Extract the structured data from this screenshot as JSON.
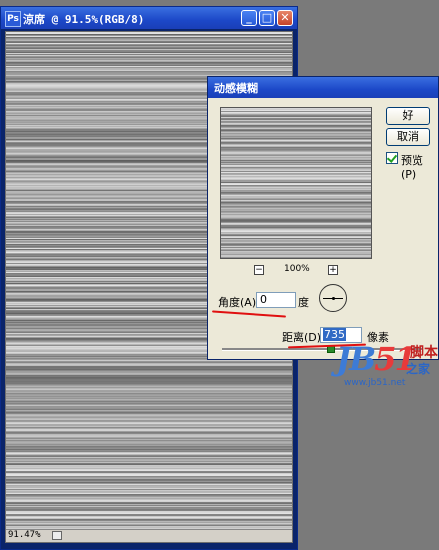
{
  "document": {
    "title": "涼席 @ 91.5%(RGB/8)",
    "minimize_label": "_",
    "restore_label": "□",
    "close_label": "✕",
    "zoom_readout": "91.47%"
  },
  "dialog": {
    "title": "动感模糊",
    "ok_label": "好",
    "cancel_label": "取消",
    "preview_checked": true,
    "preview_label": "预览(P)",
    "zoom_minus": "−",
    "zoom_plus": "+",
    "zoom_value": "100%",
    "angle_label": "角度(A):",
    "angle_value": "0",
    "angle_unit": "度",
    "distance_label": "距离(D):",
    "distance_value": "735",
    "distance_unit": "像素"
  },
  "watermark": {
    "logo_main": "JB",
    "logo_accent": "51",
    "cn_top": "脚本",
    "cn_bottom": "之家",
    "url": "www.jb51.net"
  },
  "colors": {
    "titlebar": "#1c48c8",
    "dialog_bg": "#ece9d8",
    "annotation_red": "#e01010",
    "selection": "#316ac5"
  }
}
